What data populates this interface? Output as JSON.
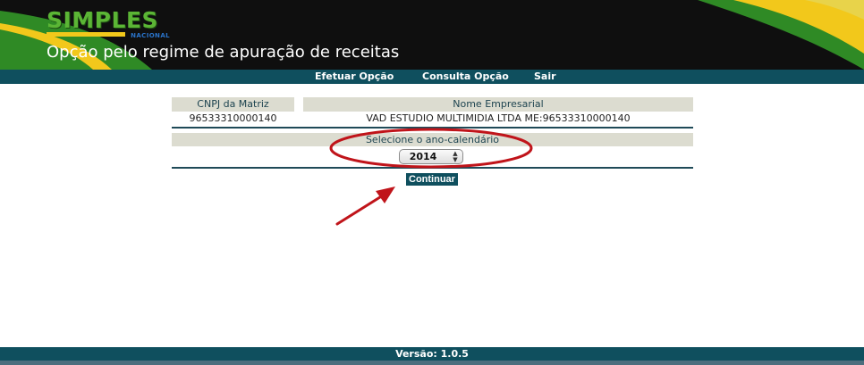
{
  "header": {
    "logo_text": "SIMPLES",
    "logo_sub": "NACIONAL",
    "page_title": "Opção pelo regime de apuração de receitas",
    "colors": {
      "green": "#3a8f2a",
      "yellow": "#f2c81b",
      "background": "#0f0f0f"
    }
  },
  "nav": {
    "items": [
      {
        "label": "Efetuar Opção"
      },
      {
        "label": "Consulta Opção"
      },
      {
        "label": "Sair"
      }
    ],
    "color": "#0f4f5e"
  },
  "form": {
    "cnpj_header": "CNPJ da Matriz",
    "cnpj_value": "96533310000140",
    "nome_header": "Nome Empresarial",
    "nome_value": "VAD ESTUDIO MULTIMIDIA LTDA ME:96533310000140",
    "year_label": "Selecione o ano-calendário",
    "year_value": "2014",
    "continue_label": "Continuar"
  },
  "annotation": {
    "ellipse_color": "#c0141a",
    "arrow_color": "#c0141a"
  },
  "footer": {
    "version": "Versão: 1.0.5"
  }
}
